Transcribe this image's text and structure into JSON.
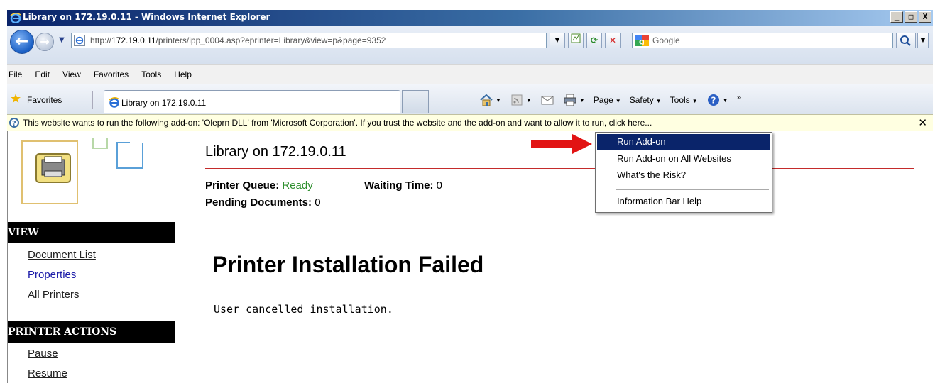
{
  "window": {
    "title": "Library on 172.19.0.11 - Windows Internet Explorer",
    "controls": {
      "minimize": "_",
      "maximize": "□",
      "close": "X"
    }
  },
  "address_bar": {
    "url_prefix": "http://",
    "url_host": "172.19.0.11",
    "url_path": "/printers/ipp_0004.asp?eprinter=Library&view=p&page=9352"
  },
  "search": {
    "placeholder": "Google"
  },
  "menu": [
    "File",
    "Edit",
    "View",
    "Favorites",
    "Tools",
    "Help"
  ],
  "favorites_bar": {
    "favorites_label": "Favorites",
    "tab_label": "Library on 172.19.0.11",
    "commands": {
      "page": "Page",
      "safety": "Safety",
      "tools": "Tools"
    }
  },
  "info_bar": {
    "text": "This website wants to run the following add-on: 'Oleprn DLL' from 'Microsoft Corporation'. If you trust the website and the add-on and want to allow it to run, click here...",
    "close": "✕"
  },
  "context_menu": {
    "items": [
      "Run Add-on",
      "Run Add-on on All Websites",
      "What's the Risk?",
      "Information Bar Help"
    ]
  },
  "sidebar": {
    "view_header": "VIEW",
    "view_links": [
      "Document List",
      "Properties",
      "All Printers"
    ],
    "actions_header": "PRINTER ACTIONS",
    "action_links": [
      "Pause",
      "Resume"
    ]
  },
  "page": {
    "title": "Library on 172.19.0.11",
    "queue_label": "Printer Queue:",
    "queue_value": "Ready",
    "waiting_label": "Waiting Time:",
    "waiting_value": "0",
    "pending_label": "Pending Documents:",
    "pending_value": "0",
    "heading": "Printer Installation Failed",
    "message": "User cancelled installation."
  },
  "colors": {
    "titlebar": "#0a246a",
    "infobar": "#ffffe1",
    "menu_highlight": "#0a246a",
    "rule": "#c42b2b",
    "ready": "#2f8f2f",
    "arrow": "#e21414"
  }
}
